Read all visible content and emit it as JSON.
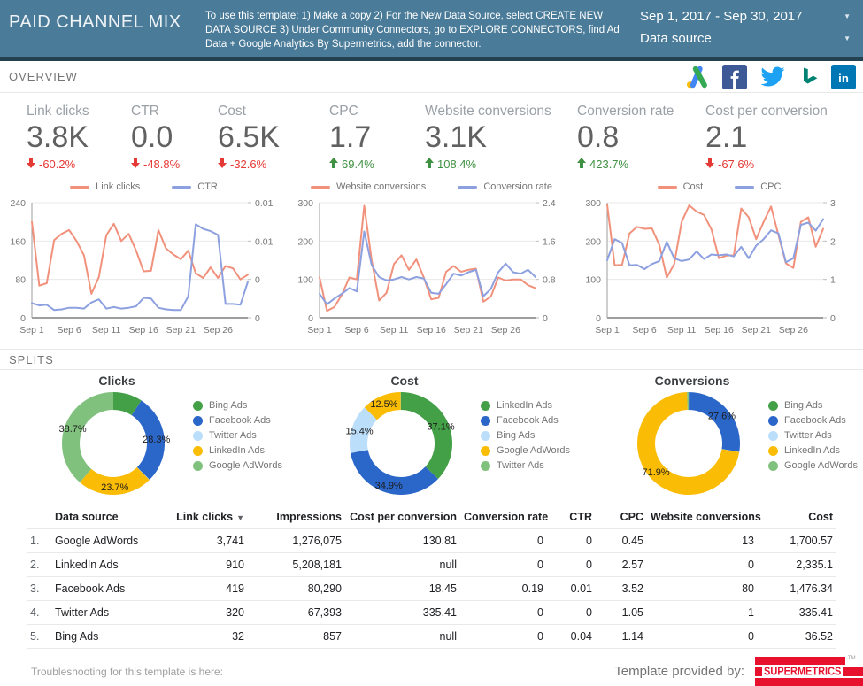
{
  "header": {
    "title": "PAID CHANNEL MIX",
    "instructions": "To use this template: 1) Make a copy 2) For the New Data Source, select CREATE NEW DATA SOURCE 3) Under Community Connectors, go to EXPLORE CONNECTORS, find  Ad Data + Google Analytics By Supermetrics, add the connector.",
    "date_range": "Sep 1, 2017 - Sep 30, 2017",
    "data_source": "Data source"
  },
  "overview": {
    "label": "OVERVIEW",
    "icons": [
      "google-adwords",
      "facebook",
      "twitter",
      "bing",
      "linkedin"
    ]
  },
  "kpis": [
    {
      "label": "Link clicks",
      "value": "3.8K",
      "delta": "-60.2%",
      "dir": "down"
    },
    {
      "label": "CTR",
      "value": "0.0",
      "delta": "-48.8%",
      "dir": "down"
    },
    {
      "label": "Cost",
      "value": "6.5K",
      "delta": "-32.6%",
      "dir": "down"
    },
    {
      "label": "CPC",
      "value": "1.7",
      "delta": "69.4%",
      "dir": "up"
    },
    {
      "label": "Website conversions",
      "value": "3.1K",
      "delta": "108.4%",
      "dir": "up"
    },
    {
      "label": "Conversion rate",
      "value": "0.8",
      "delta": "423.7%",
      "dir": "up"
    },
    {
      "label": "Cost per conversion",
      "value": "2.1",
      "delta": "-67.6%",
      "dir": "down"
    }
  ],
  "chart_data": [
    {
      "type": "line",
      "name": "link-clicks-vs-ctr",
      "x_tick_labels": [
        "Sep 1",
        "Sep 6",
        "Sep 11",
        "Sep 16",
        "Sep 21",
        "Sep 26"
      ],
      "x_tick_indices": [
        0,
        5,
        10,
        15,
        20,
        25
      ],
      "left_axis": {
        "ticks": [
          "240",
          "160",
          "80",
          "0"
        ],
        "max": 240
      },
      "right_axis": {
        "ticks": [
          "0.01",
          "0.01",
          "0",
          "0"
        ],
        "max": 0.015
      },
      "series": [
        {
          "name": "Link clicks",
          "color": "#f1917c",
          "axis": "left",
          "values": [
            200,
            67,
            72,
            162,
            175,
            183,
            160,
            130,
            50,
            85,
            172,
            196,
            160,
            175,
            140,
            97,
            98,
            183,
            145,
            132,
            122,
            140,
            93,
            83,
            105,
            83,
            108,
            103,
            80,
            90
          ]
        },
        {
          "name": "CTR",
          "color": "#8da0df",
          "axis": "right",
          "values": [
            0.0019,
            0.0016,
            0.0017,
            0.001,
            0.0011,
            0.0013,
            0.0013,
            0.0012,
            0.002,
            0.0024,
            0.0012,
            0.0014,
            0.0012,
            0.0013,
            0.0015,
            0.0026,
            0.0025,
            0.0013,
            0.0011,
            0.001,
            0.001,
            0.0028,
            0.0122,
            0.0116,
            0.0113,
            0.0108,
            0.0018,
            0.0018,
            0.0017,
            0.0047
          ]
        }
      ]
    },
    {
      "type": "line",
      "name": "website-conversions-vs-conversion-rate",
      "x_tick_labels": [
        "Sep 1",
        "Sep 6",
        "Sep 11",
        "Sep 16",
        "Sep 21",
        "Sep 26"
      ],
      "x_tick_indices": [
        0,
        5,
        10,
        15,
        20,
        25
      ],
      "left_axis": {
        "ticks": [
          "300",
          "200",
          "100",
          "0"
        ],
        "max": 300
      },
      "right_axis": {
        "ticks": [
          "2.4",
          "1.6",
          "0.8",
          "0"
        ],
        "max": 2.4
      },
      "series": [
        {
          "name": "Website conversions",
          "color": "#f1917c",
          "axis": "left",
          "values": [
            105,
            18,
            28,
            60,
            105,
            100,
            292,
            150,
            45,
            65,
            140,
            163,
            125,
            152,
            105,
            48,
            52,
            120,
            135,
            120,
            125,
            128,
            42,
            55,
            105,
            97,
            100,
            100,
            85,
            77
          ]
        },
        {
          "name": "Conversion rate",
          "color": "#8da0df",
          "axis": "right",
          "values": [
            0.5,
            0.28,
            0.4,
            0.5,
            0.62,
            0.55,
            1.8,
            1.1,
            0.85,
            0.78,
            0.8,
            0.85,
            0.8,
            0.85,
            0.82,
            0.52,
            0.5,
            0.7,
            0.92,
            0.88,
            0.95,
            1.0,
            0.45,
            0.6,
            0.95,
            1.13,
            0.95,
            0.92,
            1.0,
            0.85
          ]
        }
      ]
    },
    {
      "type": "line",
      "name": "cost-vs-cpc",
      "x_tick_labels": [
        "Sep 1",
        "Sep 6",
        "Sep 11",
        "Sep 16",
        "Sep 21",
        "Sep 26"
      ],
      "x_tick_indices": [
        0,
        5,
        10,
        15,
        20,
        25
      ],
      "left_axis": {
        "ticks": [
          "300",
          "200",
          "100",
          "0"
        ],
        "max": 300
      },
      "right_axis": {
        "ticks": [
          "3",
          "2",
          "1",
          "0"
        ],
        "max": 3
      },
      "series": [
        {
          "name": "Cost",
          "color": "#f1917c",
          "axis": "left",
          "values": [
            295,
            137,
            138,
            220,
            237,
            232,
            233,
            190,
            105,
            140,
            250,
            293,
            277,
            268,
            230,
            155,
            162,
            163,
            285,
            262,
            205,
            250,
            290,
            215,
            142,
            130,
            250,
            262,
            185,
            232
          ]
        },
        {
          "name": "CPC",
          "color": "#8da0df",
          "axis": "right",
          "values": [
            1.5,
            2.05,
            1.95,
            1.37,
            1.38,
            1.27,
            1.4,
            1.48,
            1.98,
            1.55,
            1.48,
            1.52,
            1.73,
            1.53,
            1.65,
            1.63,
            1.65,
            1.6,
            1.85,
            1.55,
            1.88,
            2.05,
            2.28,
            2.2,
            1.45,
            1.55,
            2.42,
            2.48,
            2.27,
            2.57
          ]
        }
      ]
    },
    {
      "type": "donut",
      "title": "Clicks",
      "slices": [
        {
          "label": "Bing Ads",
          "color": "#43a047",
          "value": 9.2,
          "pct": ""
        },
        {
          "label": "Facebook Ads",
          "color": "#2b66c9",
          "value": 28.3,
          "pct": "28.3%"
        },
        {
          "label": "Twitter Ads",
          "color": "#bbdefb",
          "value": 0.1,
          "pct": ""
        },
        {
          "label": "LinkedIn Ads",
          "color": "#fbbc05",
          "value": 23.7,
          "pct": "23.7%"
        },
        {
          "label": "Google AdWords",
          "color": "#81c17e",
          "value": 38.7,
          "pct": "38.7%"
        }
      ]
    },
    {
      "type": "donut",
      "title": "Cost",
      "slices": [
        {
          "label": "LinkedIn Ads",
          "color": "#43a047",
          "value": 37.1,
          "pct": "37.1%"
        },
        {
          "label": "Facebook Ads",
          "color": "#2b66c9",
          "value": 34.9,
          "pct": "34.9%"
        },
        {
          "label": "Bing Ads",
          "color": "#bbdefb",
          "value": 15.4,
          "pct": "15.4%"
        },
        {
          "label": "Google AdWords",
          "color": "#fbbc05",
          "value": 12.5,
          "pct": "12.5%"
        },
        {
          "label": "Twitter Ads",
          "color": "#81c17e",
          "value": 0.1,
          "pct": ""
        }
      ]
    },
    {
      "type": "donut",
      "title": "Conversions",
      "slices": [
        {
          "label": "Bing Ads",
          "color": "#43a047",
          "value": 0.05,
          "pct": ""
        },
        {
          "label": "Facebook Ads",
          "color": "#2b66c9",
          "value": 27.6,
          "pct": "27.6%"
        },
        {
          "label": "Twitter Ads",
          "color": "#bbdefb",
          "value": 0.05,
          "pct": ""
        },
        {
          "label": "LinkedIn Ads",
          "color": "#fbbc05",
          "value": 71.9,
          "pct": "71.9%"
        },
        {
          "label": "Google AdWords",
          "color": "#81c17e",
          "value": 0.5,
          "pct": ""
        }
      ]
    }
  ],
  "splits": {
    "label": "SPLITS"
  },
  "table": {
    "columns": [
      "Data source",
      "Link clicks",
      "Impressions",
      "Cost per conversion",
      "Conversion rate",
      "CTR",
      "CPC",
      "Website conversions",
      "Cost"
    ],
    "sorted_column": "Link clicks",
    "rows": [
      [
        "Google AdWords",
        "3,741",
        "1,276,075",
        "130.81",
        "0",
        "0",
        "0.45",
        "13",
        "1,700.57"
      ],
      [
        "LinkedIn Ads",
        "910",
        "5,208,181",
        "null",
        "0",
        "0",
        "2.57",
        "0",
        "2,335.1"
      ],
      [
        "Facebook Ads",
        "419",
        "80,290",
        "18.45",
        "0.19",
        "0.01",
        "3.52",
        "80",
        "1,476.34"
      ],
      [
        "Twitter Ads",
        "320",
        "67,393",
        "335.41",
        "0",
        "0",
        "1.05",
        "1",
        "335.41"
      ],
      [
        "Bing Ads",
        "32",
        "857",
        "null",
        "0",
        "0.04",
        "1.14",
        "0",
        "36.52"
      ]
    ]
  },
  "footer": {
    "left_text": "Troubleshooting for this template is here:",
    "right_text": "Template provided by:",
    "logo_text": "SUPERMETRICS",
    "logo_tm": "TM",
    "logo_color": "#e8112d"
  },
  "colors": {
    "header_bg": "#4a7b99",
    "header_strip": "#24414f",
    "kpi_negative": "#e53935",
    "kpi_positive": "#3f9142",
    "series_primary": "#f1917c",
    "series_secondary": "#8da0df"
  }
}
